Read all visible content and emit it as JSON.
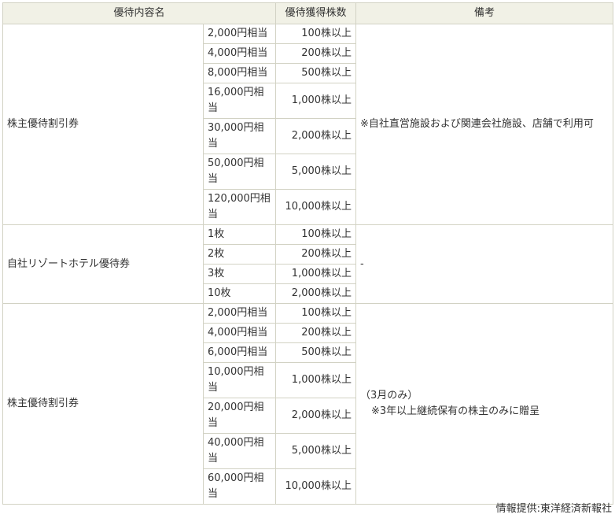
{
  "header": {
    "content_label": "優待内容名",
    "shares_label": "優待獲得株数",
    "note_label": "備考"
  },
  "groups": [
    {
      "name": "株主優待割引券",
      "note_lines": [
        "※自社直営施設および関連会社施設、店舗で利用可"
      ],
      "rows": [
        {
          "amount": "2,000円相当",
          "shares": "100株以上"
        },
        {
          "amount": "4,000円相当",
          "shares": "200株以上"
        },
        {
          "amount": "8,000円相当",
          "shares": "500株以上"
        },
        {
          "amount": "16,000円相当",
          "shares": "1,000株以上"
        },
        {
          "amount": "30,000円相当",
          "shares": "2,000株以上"
        },
        {
          "amount": "50,000円相当",
          "shares": "5,000株以上"
        },
        {
          "amount": "120,000円相当",
          "shares": "10,000株以上"
        }
      ]
    },
    {
      "name": "自社リゾートホテル優待券",
      "note_lines": [
        "-"
      ],
      "rows": [
        {
          "amount": "1枚",
          "shares": "100株以上"
        },
        {
          "amount": "2枚",
          "shares": "200株以上"
        },
        {
          "amount": "3枚",
          "shares": "1,000株以上"
        },
        {
          "amount": "10枚",
          "shares": "2,000株以上"
        }
      ]
    },
    {
      "name": "株主優待割引券",
      "note_lines": [
        "（3月のみ）",
        "※3年以上継続保有の株主のみに贈呈"
      ],
      "rows": [
        {
          "amount": "2,000円相当",
          "shares": "100株以上"
        },
        {
          "amount": "4,000円相当",
          "shares": "200株以上"
        },
        {
          "amount": "6,000円相当",
          "shares": "500株以上"
        },
        {
          "amount": "10,000円相当",
          "shares": "1,000株以上"
        },
        {
          "amount": "20,000円相当",
          "shares": "2,000株以上"
        },
        {
          "amount": "40,000円相当",
          "shares": "5,000株以上"
        },
        {
          "amount": "60,000円相当",
          "shares": "10,000株以上"
        }
      ]
    }
  ],
  "source": "情報提供:東洋経済新報社"
}
